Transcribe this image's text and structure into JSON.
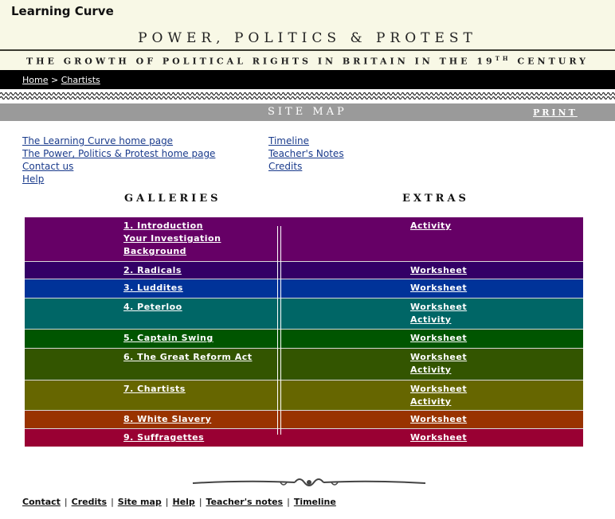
{
  "header": {
    "brand": "Learning Curve",
    "site_title": "POWER, POLITICS & PROTEST",
    "subtitle_main": "THE GROWTH OF POLITICAL RIGHTS IN BRITAIN IN THE 19",
    "subtitle_sup": "TH",
    "subtitle_end": " CENTURY"
  },
  "breadcrumb": {
    "home": "Home",
    "separator": ">",
    "current": "Chartists"
  },
  "sitemap_bar": {
    "title": "SITE MAP",
    "print": "PRINT"
  },
  "links_left": [
    "The Learning Curve home page",
    "The Power, Politics & Protest home page",
    "Contact us",
    "Help"
  ],
  "links_right": [
    "Timeline",
    "Teacher's Notes",
    "Credits"
  ],
  "columns": {
    "galleries": "GALLERIES",
    "extras": "EXTRAS"
  },
  "rows": [
    {
      "color": "#660066",
      "galleries": [
        "1. Introduction",
        "Your Investigation",
        "Background"
      ],
      "extras": [
        "Activity"
      ]
    },
    {
      "color": "#330066",
      "galleries": [
        "2. Radicals"
      ],
      "extras": [
        "Worksheet"
      ]
    },
    {
      "color": "#003399",
      "galleries": [
        "3. Luddites"
      ],
      "extras": [
        "Worksheet"
      ]
    },
    {
      "color": "#006666",
      "galleries": [
        "4. Peterloo"
      ],
      "extras": [
        "Worksheet",
        "Activity"
      ]
    },
    {
      "color": "#005500",
      "galleries": [
        "5. Captain Swing"
      ],
      "extras": [
        "Worksheet"
      ]
    },
    {
      "color": "#335500",
      "galleries": [
        "6. The Great Reform Act"
      ],
      "extras": [
        "Worksheet",
        "Activity"
      ]
    },
    {
      "color": "#666600",
      "galleries": [
        "7. Chartists"
      ],
      "extras": [
        "Worksheet",
        "Activity"
      ]
    },
    {
      "color": "#993300",
      "galleries": [
        "8. White Slavery"
      ],
      "extras": [
        "Worksheet"
      ]
    },
    {
      "color": "#990033",
      "galleries": [
        "9. Suffragettes"
      ],
      "extras": [
        "Worksheet"
      ]
    }
  ],
  "footer": [
    "Contact",
    "Credits",
    "Site map",
    "Help",
    "Teacher's notes",
    "Timeline"
  ]
}
